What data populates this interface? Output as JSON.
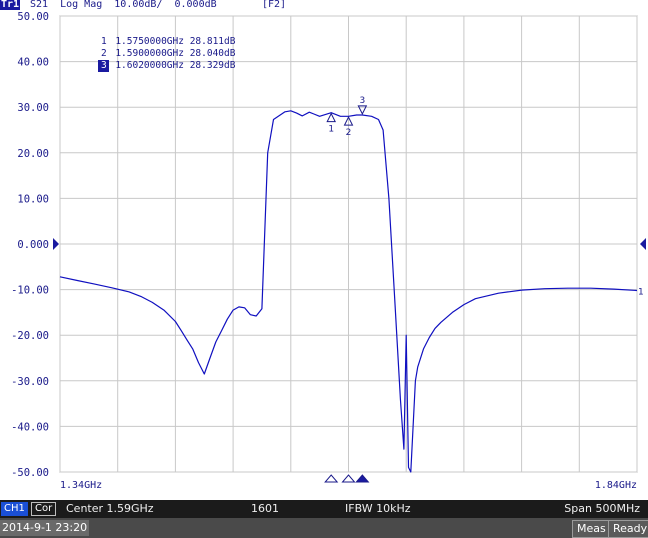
{
  "header": {
    "trace_id": "Tr1",
    "text": "S21  Log Mag  10.00dB/  0.000dB",
    "function_key": "[F2]"
  },
  "markers": [
    {
      "number": "1",
      "frequency": "1.5750000GHz",
      "value": "28.811dB",
      "active": false
    },
    {
      "number": "2",
      "frequency": "1.5900000GHz",
      "value": "28.040dB",
      "active": false
    },
    {
      "number": "3",
      "frequency": "1.6020000GHz",
      "value": "28.329dB",
      "active": true
    }
  ],
  "chart_data": {
    "type": "line",
    "title": "",
    "xlabel": "",
    "ylabel": "",
    "y_unit": "dB",
    "x_unit": "GHz",
    "xlim": [
      1.34,
      1.84
    ],
    "ylim": [
      -50,
      50
    ],
    "y_ticks": [
      50,
      40,
      30,
      20,
      10,
      0,
      -10,
      -20,
      -30,
      -40,
      -50
    ],
    "y_tick_labels": [
      "50.00",
      "40.00",
      "30.00",
      "20.00",
      "10.00",
      "0.000",
      "-10.00",
      "-20.00",
      "-30.00",
      "-40.00",
      "-50.00"
    ],
    "x_tick_labels": [
      "1.34GHz",
      "1.84GHz"
    ],
    "grid": true,
    "reference_level": 0,
    "series": [
      {
        "trace_end_label": "1",
        "color": "#1010c0",
        "x": [
          1.34,
          1.355,
          1.37,
          1.385,
          1.4,
          1.41,
          1.42,
          1.43,
          1.44,
          1.445,
          1.45,
          1.455,
          1.46,
          1.465,
          1.47,
          1.475,
          1.48,
          1.485,
          1.49,
          1.495,
          1.5,
          1.505,
          1.51,
          1.515,
          1.52,
          1.525,
          1.535,
          1.54,
          1.545,
          1.55,
          1.556,
          1.56,
          1.565,
          1.575,
          1.583,
          1.59,
          1.597,
          1.602,
          1.61,
          1.616,
          1.62,
          1.625,
          1.63,
          1.635,
          1.638,
          1.64,
          1.642,
          1.644,
          1.646,
          1.648,
          1.65,
          1.655,
          1.66,
          1.665,
          1.67,
          1.68,
          1.69,
          1.7,
          1.72,
          1.74,
          1.76,
          1.78,
          1.8,
          1.82,
          1.84
        ],
        "y": [
          -7.2,
          -8.0,
          -8.8,
          -9.6,
          -10.5,
          -11.5,
          -12.8,
          -14.5,
          -17.0,
          -19.0,
          -21.0,
          -23.0,
          -26.0,
          -28.5,
          -25.0,
          -21.5,
          -19.0,
          -16.5,
          -14.5,
          -13.8,
          -14.0,
          -15.5,
          -15.8,
          -14.2,
          20.0,
          27.3,
          29.0,
          29.2,
          28.7,
          28.1,
          28.9,
          28.5,
          28.0,
          28.8,
          28.0,
          28.0,
          28.3,
          28.3,
          28.0,
          27.3,
          25.0,
          10.0,
          -12.0,
          -34.0,
          -45.0,
          -20.0,
          -49.0,
          -50.0,
          -40.0,
          -30.0,
          -27.0,
          -23.0,
          -20.5,
          -18.5,
          -17.2,
          -15.0,
          -13.3,
          -12.0,
          -10.8,
          -10.1,
          -9.8,
          -9.7,
          -9.7,
          -9.9,
          -10.2
        ]
      }
    ],
    "markers": [
      {
        "number": "1",
        "x": 1.575,
        "y": 28.811
      },
      {
        "number": "2",
        "x": 1.59,
        "y": 28.04
      },
      {
        "number": "3",
        "x": 1.602,
        "y": 28.329
      }
    ]
  },
  "status": {
    "channel": "CH1",
    "correction": "Cor",
    "center": "Center 1.59GHz",
    "points": "1601",
    "ifbw": "IFBW 10kHz",
    "span": "Span 500MHz"
  },
  "footer": {
    "datetime": "2014-9-1 23:20",
    "meas_label": "Meas",
    "ready_label": "Ready"
  }
}
